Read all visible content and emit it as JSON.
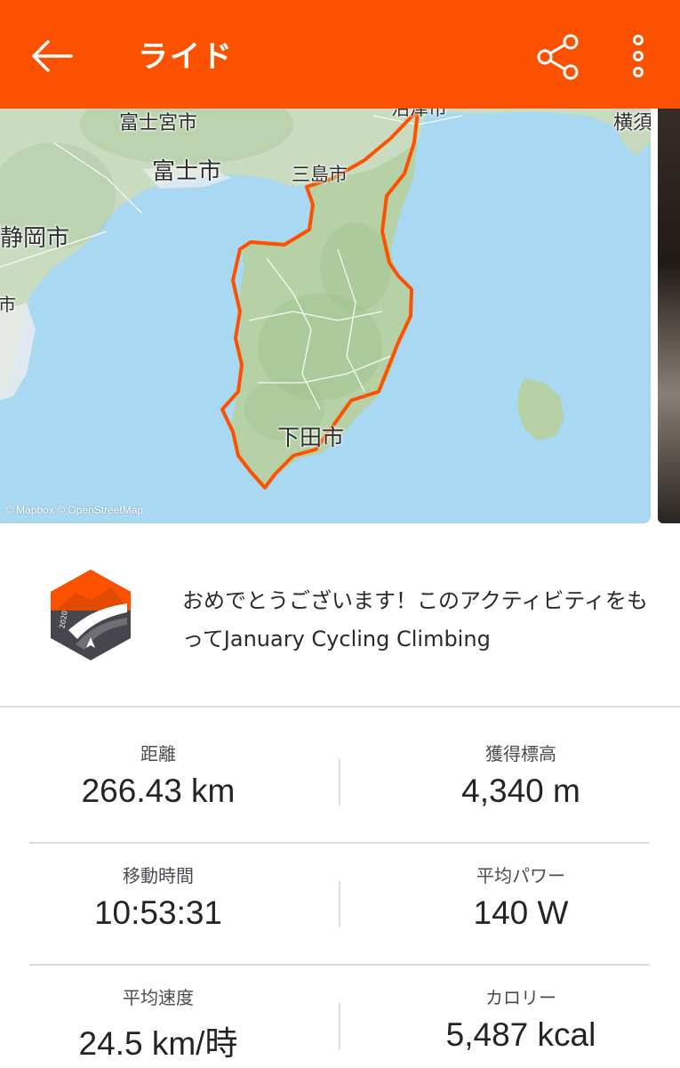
{
  "app_bar": {
    "title": "ライド",
    "back_icon": "arrow-left-icon",
    "share_icon": "share-icon",
    "more_icon": "more-vertical-icon",
    "background": "#fc5200"
  },
  "map": {
    "labels": {
      "fujinomiya": "富士宮市",
      "fuji": "富士市",
      "shizuoka": "静岡市",
      "mishima": "三島市",
      "shimoda": "下田市",
      "numazu_partial": "沼津市",
      "yokosuka_partial": "横須",
      "left_partial": "市"
    },
    "attribution": "© Mapbox © OpenStreetMap",
    "route_color": "#fc5200",
    "sea_color": "#a9d8f2",
    "land_color": "#b9d3ad"
  },
  "achievement": {
    "icon": "challenge-badge-icon",
    "badge_year": "2020",
    "text": "おめでとうございます！このアクティビティをもってJanuary Cycling Climbing"
  },
  "stats": {
    "distance": {
      "label": "距離",
      "value": "266.43 km"
    },
    "elevation": {
      "label": "獲得標高",
      "value": "4,340 m"
    },
    "moving_time": {
      "label": "移動時間",
      "value": "10:53:31"
    },
    "avg_power": {
      "label": "平均パワー",
      "value": "140 W"
    },
    "avg_speed": {
      "label": "平均速度",
      "value": "24.5 km/時"
    },
    "calories": {
      "label": "カロリー",
      "value": "5,487 kcal"
    }
  }
}
